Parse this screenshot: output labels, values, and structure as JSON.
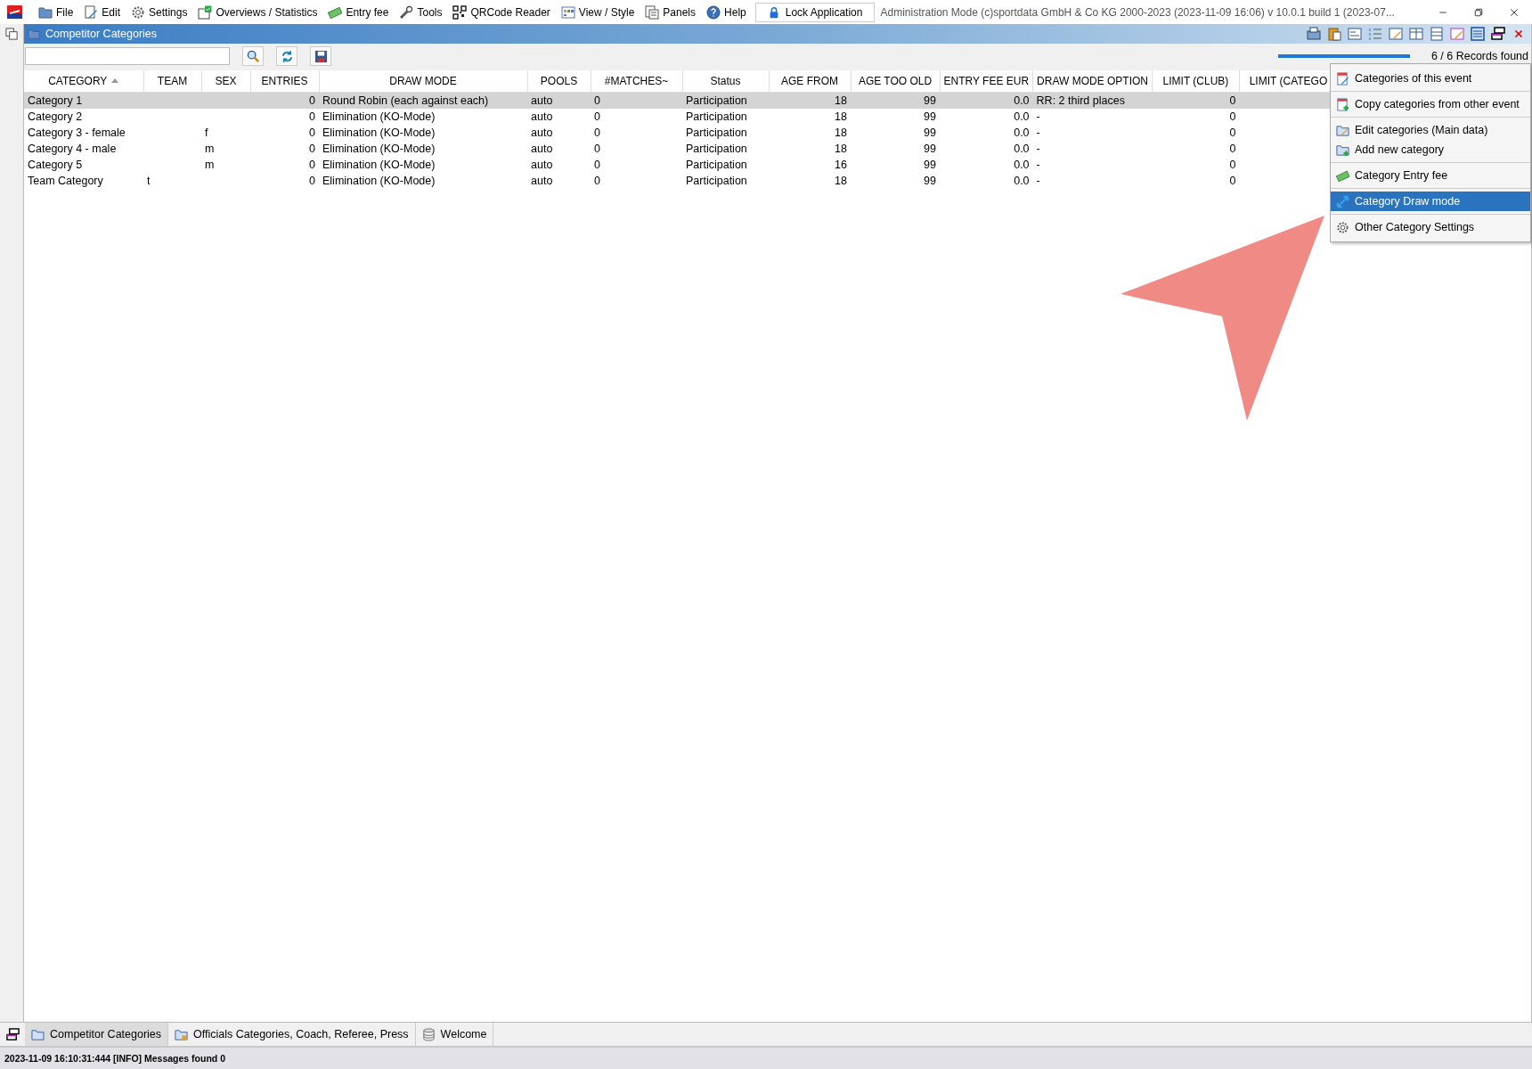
{
  "menu_bar": {
    "items": [
      {
        "label": "File"
      },
      {
        "label": "Edit"
      },
      {
        "label": "Settings"
      },
      {
        "label": "Overviews / Statistics"
      },
      {
        "label": "Entry fee"
      },
      {
        "label": "Tools"
      },
      {
        "label": "QRCode Reader"
      },
      {
        "label": "View / Style"
      },
      {
        "label": "Panels"
      },
      {
        "label": "Help"
      }
    ],
    "lock_button": "Lock Application",
    "app_info": "Administration Mode (c)sportdata GmbH & Co KG 2000-2023 (2023-11-09 16:06)  v 10.0.1 build 1 (2023-07..."
  },
  "panel": {
    "title": "Competitor Categories",
    "progress": {
      "level": 1
    },
    "records": "6 / 6 Records found"
  },
  "table": {
    "columns": [
      {
        "label": "CATEGORY",
        "sorted": true
      },
      {
        "label": "TEAM",
        "sorted": false
      },
      {
        "label": "SEX",
        "sorted": false
      },
      {
        "label": "ENTRIES",
        "sorted": false
      },
      {
        "label": "DRAW MODE",
        "sorted": false
      },
      {
        "label": "POOLS",
        "sorted": false
      },
      {
        "label": "#MATCHES~",
        "sorted": false
      },
      {
        "label": "Status",
        "sorted": false
      },
      {
        "label": "AGE FROM",
        "sorted": false
      },
      {
        "label": "AGE TOO OLD",
        "sorted": false
      },
      {
        "label": "ENTRY FEE EUR",
        "sorted": false
      },
      {
        "label": "DRAW MODE OPTION",
        "sorted": false
      },
      {
        "label": "LIMIT (CLUB)",
        "sorted": false
      },
      {
        "label": "LIMIT (CATEGO",
        "sorted": false
      }
    ],
    "rows": [
      {
        "selected": true,
        "cells": [
          "Category 1",
          "",
          "",
          "0",
          "Round Robin (each against each)",
          "auto",
          "0",
          "Participation",
          "18",
          "99",
          "0.0",
          "RR: 2 third places",
          "0"
        ]
      },
      {
        "selected": false,
        "cells": [
          "Category 2",
          "",
          "",
          "0",
          "Elimination (KO-Mode)",
          "auto",
          "0",
          "Participation",
          "18",
          "99",
          "0.0",
          "-",
          "0"
        ]
      },
      {
        "selected": false,
        "cells": [
          "Category 3 - female",
          "",
          "f",
          "0",
          "Elimination (KO-Mode)",
          "auto",
          "0",
          "Participation",
          "18",
          "99",
          "0.0",
          "-",
          "0"
        ]
      },
      {
        "selected": false,
        "cells": [
          "Category 4 - male",
          "",
          "m",
          "0",
          "Elimination (KO-Mode)",
          "auto",
          "0",
          "Participation",
          "18",
          "99",
          "0.0",
          "-",
          "0"
        ]
      },
      {
        "selected": false,
        "cells": [
          "Category 5",
          "",
          "m",
          "0",
          "Elimination (KO-Mode)",
          "auto",
          "0",
          "Participation",
          "16",
          "99",
          "0.0",
          "-",
          "0"
        ]
      },
      {
        "selected": false,
        "cells": [
          "Team Category",
          "t",
          "",
          "0",
          "Elimination (KO-Mode)",
          "auto",
          "0",
          "Participation",
          "18",
          "99",
          "0.0",
          "-",
          "0"
        ]
      }
    ]
  },
  "context_menu": {
    "groups": [
      [
        {
          "label": "Categories of this event",
          "selected": false
        }
      ],
      [
        {
          "label": "Copy categories from other event",
          "selected": false
        }
      ],
      [
        {
          "label": "Edit categories (Main data)",
          "selected": false
        },
        {
          "label": "Add new category",
          "selected": false
        }
      ],
      [
        {
          "label": "Category Entry fee",
          "selected": false
        }
      ],
      [
        {
          "label": "Category Draw mode",
          "selected": true
        }
      ],
      [
        {
          "label": "Other Category Settings",
          "selected": false
        }
      ]
    ]
  },
  "tabs": [
    {
      "label": "Competitor Categories",
      "selected": true
    },
    {
      "label": "Officials Categories, Coach, Referee, Press",
      "selected": false
    },
    {
      "label": "Welcome",
      "selected": false
    }
  ],
  "status_bar": "2023-11-09 16:10:31:444 [INFO] Messages found 0"
}
